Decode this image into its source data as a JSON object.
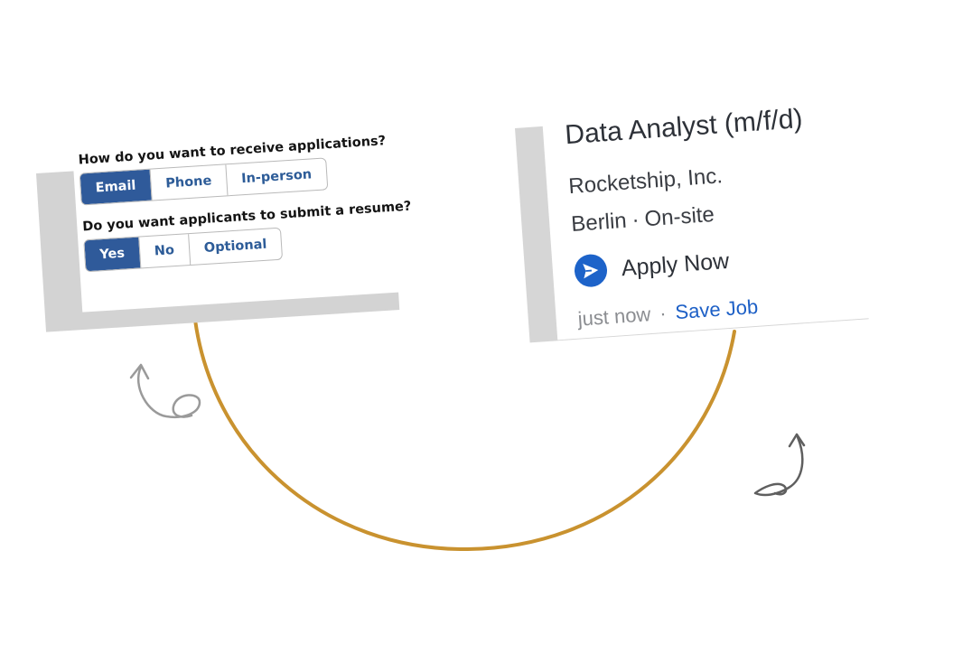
{
  "colors": {
    "accent": "#2f5a9a",
    "link": "#1c5fc6",
    "apply_icon": "#1d63c9",
    "connector_arc": "#c9922f"
  },
  "form": {
    "q1": "How do you want to receive applications?",
    "q1_options": [
      {
        "label": "Email",
        "selected": true
      },
      {
        "label": "Phone",
        "selected": false
      },
      {
        "label": "In-person",
        "selected": false
      }
    ],
    "q2": "Do you want applicants to submit a resume?",
    "q2_options": [
      {
        "label": "Yes",
        "selected": true
      },
      {
        "label": "No",
        "selected": false
      },
      {
        "label": "Optional",
        "selected": false
      }
    ]
  },
  "job": {
    "title": "Data Analyst (m/f/d)",
    "company": "Rocketship, Inc.",
    "city": "Berlin",
    "separator": "·",
    "work_type": "On-site",
    "apply_label": "Apply Now",
    "apply_icon": "send-icon",
    "posted": "just now",
    "save_label": "Save Job"
  },
  "decor": {
    "left_arrow": "curly-arrow-up-icon",
    "right_arrow": "curly-arrow-up-icon"
  }
}
